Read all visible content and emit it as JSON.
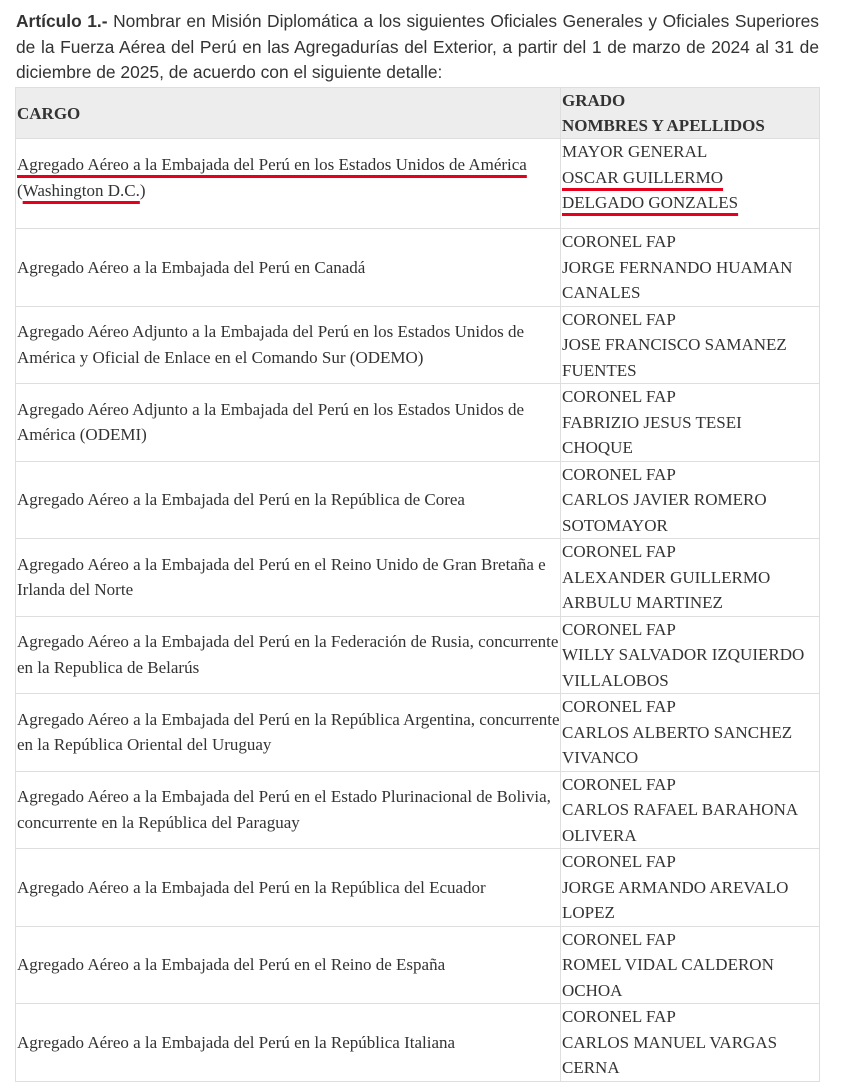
{
  "intro": {
    "heading": "Artículo 1.-",
    "text": "Nombrar en Misión Diplomática a los siguientes Oficiales Generales y Oficiales Superiores de la Fuerza Aérea del Perú en las Agregadurías del Exterior, a partir del 1 de marzo de 2024 al 31 de diciembre de 2025, de acuerdo con el siguiente detalle:"
  },
  "table": {
    "headers": {
      "cargo": "CARGO",
      "grado": "GRADO",
      "nombres": "NOMBRES Y APELLIDOS"
    },
    "rows": [
      {
        "cargo": "Agregado Aéreo a la Embajada del Perú en los Estados Unidos de América (Washington D.C.)",
        "cargo_line1": "Agregado Aéreo a la Embajada del Perú en los Estados Unidos de América",
        "cargo_paren_open": "(",
        "cargo_line2": "Washington D.C.",
        "cargo_paren_close": ")",
        "grado": "MAYOR GENERAL",
        "nombre1": "OSCAR GUILLERMO",
        "nombre2": "DELGADO GONZALES"
      },
      {
        "cargo": "Agregado Aéreo a la Embajada del Perú en Canadá",
        "grado": "CORONEL FAP",
        "nombre1": "JORGE FERNANDO HUAMAN",
        "nombre2": "CANALES"
      },
      {
        "cargo": "Agregado Aéreo Adjunto a la Embajada del Perú en los Estados Unidos de América y Oficial de Enlace en el Comando Sur (ODEMO)",
        "grado": "CORONEL FAP",
        "nombre1": "JOSE FRANCISCO SAMANEZ",
        "nombre2": "FUENTES"
      },
      {
        "cargo": "Agregado Aéreo Adjunto a la Embajada del Perú en los Estados Unidos de América (ODEMI)",
        "grado": "CORONEL FAP",
        "nombre1": "FABRIZIO JESUS TESEI",
        "nombre2": "CHOQUE"
      },
      {
        "cargo": "Agregado Aéreo a la Embajada del Perú en la República de Corea",
        "grado": "CORONEL FAP",
        "nombre1": "CARLOS JAVIER ROMERO",
        "nombre2": "SOTOMAYOR"
      },
      {
        "cargo": "Agregado Aéreo a la Embajada del Perú en el Reino Unido de Gran Bretaña e Irlanda del Norte",
        "grado": "CORONEL FAP",
        "nombre1": "ALEXANDER GUILLERMO",
        "nombre2": "ARBULU MARTINEZ"
      },
      {
        "cargo": "Agregado Aéreo a la Embajada del Perú en la Federación de Rusia, concurrente en la Republica de Belarús",
        "grado": "CORONEL FAP",
        "nombre1": "WILLY SALVADOR IZQUIERDO",
        "nombre2": "VILLALOBOS"
      },
      {
        "cargo": "Agregado Aéreo a la Embajada del Perú en la República Argentina, concurrente en la República Oriental del Uruguay",
        "grado": "CORONEL FAP",
        "nombre1": "CARLOS ALBERTO SANCHEZ",
        "nombre2": "VIVANCO"
      },
      {
        "cargo": "Agregado Aéreo a la Embajada del Perú en el Estado Plurinacional de Bolivia, concurrente en la República del Paraguay",
        "grado": "CORONEL FAP",
        "nombre1": "CARLOS RAFAEL BARAHONA",
        "nombre2": "OLIVERA"
      },
      {
        "cargo": "Agregado Aéreo a la Embajada del Perú en la República del Ecuador",
        "grado": "CORONEL FAP",
        "nombre1": "JORGE ARMANDO AREVALO",
        "nombre2": "LOPEZ"
      },
      {
        "cargo": "Agregado Aéreo a la Embajada del Perú en el Reino de España",
        "grado": "CORONEL FAP",
        "nombre1": "ROMEL VIDAL CALDERON",
        "nombre2": "OCHOA"
      },
      {
        "cargo": "Agregado Aéreo a la Embajada del Perú en la República Italiana",
        "grado": "CORONEL FAP",
        "nombre1": "CARLOS MANUEL VARGAS",
        "nombre2": "CERNA"
      }
    ]
  },
  "colors": {
    "text": "#333333",
    "header_bg": "#ededed",
    "border": "#dedede",
    "highlight_underline": "#e6001e"
  }
}
